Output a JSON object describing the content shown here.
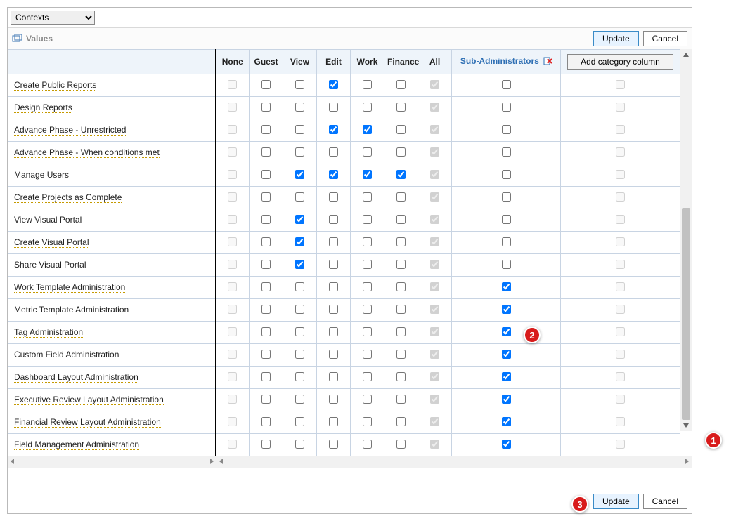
{
  "header": {
    "context_dropdown_value": "Contexts",
    "values_label": "Values",
    "update_label": "Update",
    "cancel_label": "Cancel"
  },
  "columns": {
    "none": "None",
    "guest": "Guest",
    "view": "View",
    "edit": "Edit",
    "work": "Work",
    "finance": "Finance",
    "all": "All",
    "sub": "Sub-Administrators",
    "add_btn": "Add category column"
  },
  "rows": [
    {
      "label": "Create Public Reports",
      "none": "d",
      "guest": "u",
      "view": "u",
      "edit": "c",
      "work": "u",
      "finance": "u",
      "all": "dc",
      "sub": "u",
      "add": "d"
    },
    {
      "label": "Design Reports",
      "none": "d",
      "guest": "u",
      "view": "u",
      "edit": "u",
      "work": "u",
      "finance": "u",
      "all": "dc",
      "sub": "u",
      "add": "d"
    },
    {
      "label": "Advance Phase - Unrestricted",
      "none": "d",
      "guest": "u",
      "view": "u",
      "edit": "c",
      "work": "c",
      "finance": "u",
      "all": "dc",
      "sub": "u",
      "add": "d"
    },
    {
      "label": "Advance Phase - When conditions met",
      "none": "d",
      "guest": "u",
      "view": "u",
      "edit": "u",
      "work": "u",
      "finance": "u",
      "all": "dc",
      "sub": "u",
      "add": "d"
    },
    {
      "label": "Manage Users",
      "none": "d",
      "guest": "u",
      "view": "c",
      "edit": "c",
      "work": "c",
      "finance": "c",
      "all": "dc",
      "sub": "u",
      "add": "d"
    },
    {
      "label": "Create Projects as Complete",
      "none": "d",
      "guest": "u",
      "view": "u",
      "edit": "u",
      "work": "u",
      "finance": "u",
      "all": "dc",
      "sub": "u",
      "add": "d"
    },
    {
      "label": "View Visual Portal",
      "none": "d",
      "guest": "u",
      "view": "c",
      "edit": "u",
      "work": "u",
      "finance": "u",
      "all": "dc",
      "sub": "u",
      "add": "d"
    },
    {
      "label": "Create Visual Portal",
      "none": "d",
      "guest": "u",
      "view": "c",
      "edit": "u",
      "work": "u",
      "finance": "u",
      "all": "dc",
      "sub": "u",
      "add": "d"
    },
    {
      "label": "Share Visual Portal",
      "none": "d",
      "guest": "u",
      "view": "c",
      "edit": "u",
      "work": "u",
      "finance": "u",
      "all": "dc",
      "sub": "u",
      "add": "d"
    },
    {
      "label": "Work Template Administration",
      "none": "d",
      "guest": "u",
      "view": "u",
      "edit": "u",
      "work": "u",
      "finance": "u",
      "all": "dc",
      "sub": "c",
      "add": "d"
    },
    {
      "label": "Metric Template Administration",
      "none": "d",
      "guest": "u",
      "view": "u",
      "edit": "u",
      "work": "u",
      "finance": "u",
      "all": "dc",
      "sub": "c",
      "add": "d"
    },
    {
      "label": "Tag Administration",
      "none": "d",
      "guest": "u",
      "view": "u",
      "edit": "u",
      "work": "u",
      "finance": "u",
      "all": "dc",
      "sub": "c",
      "add": "d"
    },
    {
      "label": "Custom Field Administration",
      "none": "d",
      "guest": "u",
      "view": "u",
      "edit": "u",
      "work": "u",
      "finance": "u",
      "all": "dc",
      "sub": "c",
      "add": "d"
    },
    {
      "label": "Dashboard Layout Administration",
      "none": "d",
      "guest": "u",
      "view": "u",
      "edit": "u",
      "work": "u",
      "finance": "u",
      "all": "dc",
      "sub": "c",
      "add": "d"
    },
    {
      "label": "Executive Review Layout Administration",
      "none": "d",
      "guest": "u",
      "view": "u",
      "edit": "u",
      "work": "u",
      "finance": "u",
      "all": "dc",
      "sub": "c",
      "add": "d"
    },
    {
      "label": "Financial Review Layout Administration",
      "none": "d",
      "guest": "u",
      "view": "u",
      "edit": "u",
      "work": "u",
      "finance": "u",
      "all": "dc",
      "sub": "c",
      "add": "d"
    },
    {
      "label": "Field Management Administration",
      "none": "d",
      "guest": "u",
      "view": "u",
      "edit": "u",
      "work": "u",
      "finance": "u",
      "all": "dc",
      "sub": "c",
      "add": "d"
    }
  ],
  "footer": {
    "update_label": "Update",
    "cancel_label": "Cancel"
  },
  "callouts": {
    "one": "1",
    "two": "2",
    "three": "3"
  }
}
